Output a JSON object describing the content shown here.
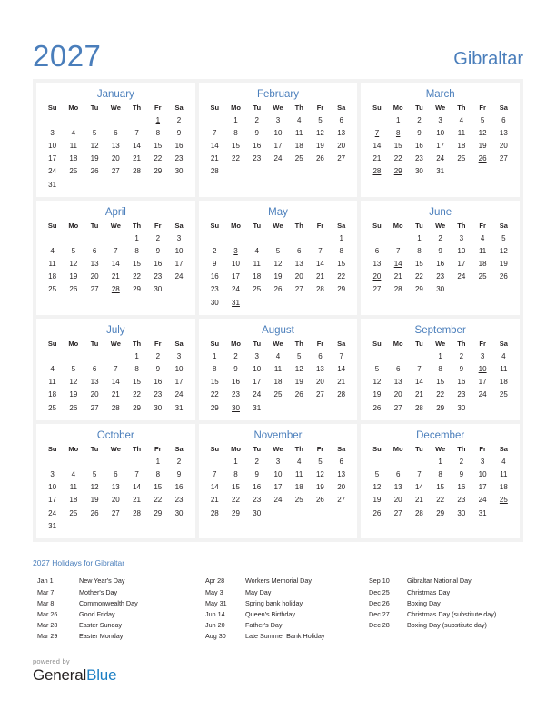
{
  "header": {
    "year": "2027",
    "country": "Gibraltar"
  },
  "weekday_headers": [
    "Su",
    "Mo",
    "Tu",
    "We",
    "Th",
    "Fr",
    "Sa"
  ],
  "months": [
    {
      "name": "January",
      "first_weekday": 5,
      "days_in_month": 31,
      "holidays": [
        1
      ]
    },
    {
      "name": "February",
      "first_weekday": 1,
      "days_in_month": 28,
      "holidays": []
    },
    {
      "name": "March",
      "first_weekday": 1,
      "days_in_month": 31,
      "holidays": [
        7,
        8,
        26,
        28,
        29
      ]
    },
    {
      "name": "April",
      "first_weekday": 4,
      "days_in_month": 30,
      "holidays": [
        28
      ]
    },
    {
      "name": "May",
      "first_weekday": 6,
      "days_in_month": 31,
      "holidays": [
        3,
        31
      ]
    },
    {
      "name": "June",
      "first_weekday": 2,
      "days_in_month": 30,
      "holidays": [
        14,
        20
      ]
    },
    {
      "name": "July",
      "first_weekday": 4,
      "days_in_month": 31,
      "holidays": []
    },
    {
      "name": "August",
      "first_weekday": 0,
      "days_in_month": 31,
      "holidays": [
        30
      ]
    },
    {
      "name": "September",
      "first_weekday": 3,
      "days_in_month": 30,
      "holidays": [
        10
      ]
    },
    {
      "name": "October",
      "first_weekday": 5,
      "days_in_month": 31,
      "holidays": []
    },
    {
      "name": "November",
      "first_weekday": 1,
      "days_in_month": 30,
      "holidays": []
    },
    {
      "name": "December",
      "first_weekday": 3,
      "days_in_month": 31,
      "holidays": [
        25,
        26,
        27,
        28
      ]
    }
  ],
  "holidays_section": {
    "title": "2027 Holidays for Gibraltar",
    "columns": [
      [
        {
          "date": "Jan 1",
          "name": "New Year's Day"
        },
        {
          "date": "Mar 7",
          "name": "Mother's Day"
        },
        {
          "date": "Mar 8",
          "name": "Commonwealth Day"
        },
        {
          "date": "Mar 26",
          "name": "Good Friday"
        },
        {
          "date": "Mar 28",
          "name": "Easter Sunday"
        },
        {
          "date": "Mar 29",
          "name": "Easter Monday"
        }
      ],
      [
        {
          "date": "Apr 28",
          "name": "Workers Memorial Day"
        },
        {
          "date": "May 3",
          "name": "May Day"
        },
        {
          "date": "May 31",
          "name": "Spring bank holiday"
        },
        {
          "date": "Jun 14",
          "name": "Queen's Birthday"
        },
        {
          "date": "Jun 20",
          "name": "Father's Day"
        },
        {
          "date": "Aug 30",
          "name": "Late Summer Bank Holiday"
        }
      ],
      [
        {
          "date": "Sep 10",
          "name": "Gibraltar National Day"
        },
        {
          "date": "Dec 25",
          "name": "Christmas Day"
        },
        {
          "date": "Dec 26",
          "name": "Boxing Day"
        },
        {
          "date": "Dec 27",
          "name": "Christmas Day (substitute day)"
        },
        {
          "date": "Dec 28",
          "name": "Boxing Day (substitute day)"
        }
      ]
    ]
  },
  "footer": {
    "powered_by": "powered by",
    "logo_first": "General",
    "logo_second": "Blue"
  },
  "colors": {
    "accent_blue": "#4a7ebb",
    "holiday_red": "#ee0000",
    "logo_blue": "#1c7fc4",
    "panel_gray": "#f2f2f2"
  }
}
